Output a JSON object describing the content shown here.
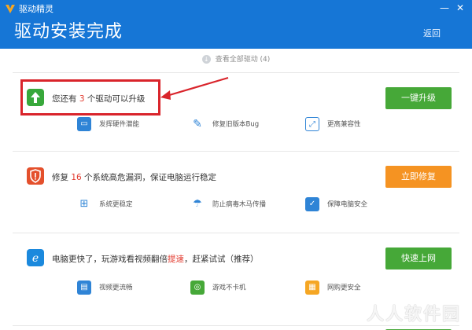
{
  "app": {
    "name": "驱动精灵",
    "title": "驱动安装完成",
    "back_label": "返回"
  },
  "window_controls": {
    "minimize": "—",
    "close": "✕"
  },
  "view_all": {
    "label": "查看全部驱动 (4)",
    "icon_text": "↓"
  },
  "cards": [
    {
      "prefix": "您还有 ",
      "count": "3",
      "suffix": " 个驱动可以升级",
      "button": "一键升级",
      "features": [
        "发挥硬件潜能",
        "修复旧版本Bug",
        "更高兼容性"
      ]
    },
    {
      "prefix": "修复 ",
      "count": "16",
      "suffix": " 个系统高危漏洞，保证电脑运行稳定",
      "button": "立即修复",
      "features": [
        "系统更稳定",
        "防止病毒木马传播",
        "保障电脑安全"
      ]
    },
    {
      "prefix": "电脑更快了，玩游戏看视频翻倍",
      "count": "提速",
      "suffix": "，赶紧试试（推荐）",
      "button": "快速上网",
      "features": [
        "视频更流畅",
        "游戏不卡机",
        "网购更安全"
      ]
    }
  ],
  "watermark": "人人软件园",
  "colors": {
    "header": "#1676d6",
    "green_button": "#46a838",
    "orange_button": "#f59322",
    "highlight": "#d9242b",
    "accent_text": "#e23a2e"
  }
}
